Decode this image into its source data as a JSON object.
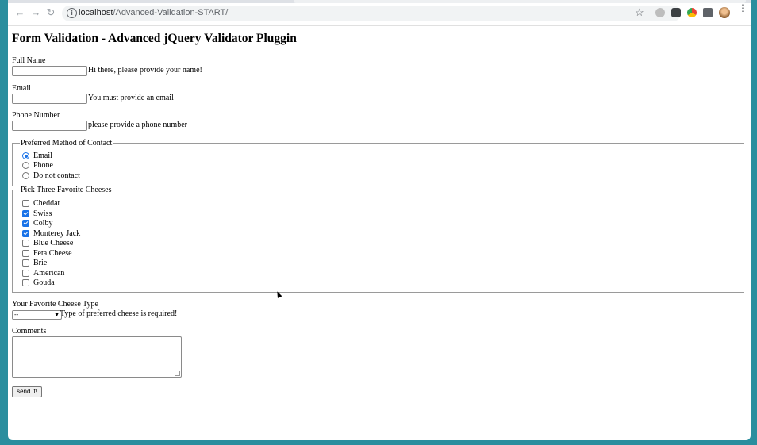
{
  "browser": {
    "url_host": "localhost",
    "url_path": "/Advanced-Validation-START/",
    "back_icon": "arrow-left-icon",
    "forward_icon": "arrow-right-icon",
    "reload_icon": "reload-icon"
  },
  "page": {
    "title": "Form Validation - Advanced jQuery Validator Pluggin",
    "full_name": {
      "label": "Full Name",
      "value": "",
      "hint": "Hi there, please provide your name!"
    },
    "email": {
      "label": "Email",
      "value": "",
      "hint": "You must provide an email"
    },
    "phone": {
      "label": "Phone Number",
      "value": "",
      "hint": "please provide a phone number"
    },
    "contact": {
      "legend": "Preferred Method of Contact",
      "options": [
        {
          "label": "Email",
          "checked": true
        },
        {
          "label": "Phone",
          "checked": false
        },
        {
          "label": "Do not contact",
          "checked": false
        }
      ]
    },
    "cheeses": {
      "legend": "Pick Three Favorite Cheeses",
      "options": [
        {
          "label": "Cheddar",
          "checked": false
        },
        {
          "label": "Swiss",
          "checked": true
        },
        {
          "label": "Colby",
          "checked": true
        },
        {
          "label": "Monterey Jack",
          "checked": true
        },
        {
          "label": "Blue Cheese",
          "checked": false
        },
        {
          "label": "Feta Cheese",
          "checked": false
        },
        {
          "label": "Brie",
          "checked": false
        },
        {
          "label": "American",
          "checked": false
        },
        {
          "label": "Gouda",
          "checked": false
        }
      ]
    },
    "cheese_type": {
      "label": "Your Favorite Cheese Type",
      "selected": "--",
      "hint": "Type of preferred cheese is required!"
    },
    "comments": {
      "label": "Comments",
      "value": ""
    },
    "submit_label": "send it!"
  },
  "colors": {
    "accent": "#1a73e8",
    "frame": "#2a8e9e"
  }
}
